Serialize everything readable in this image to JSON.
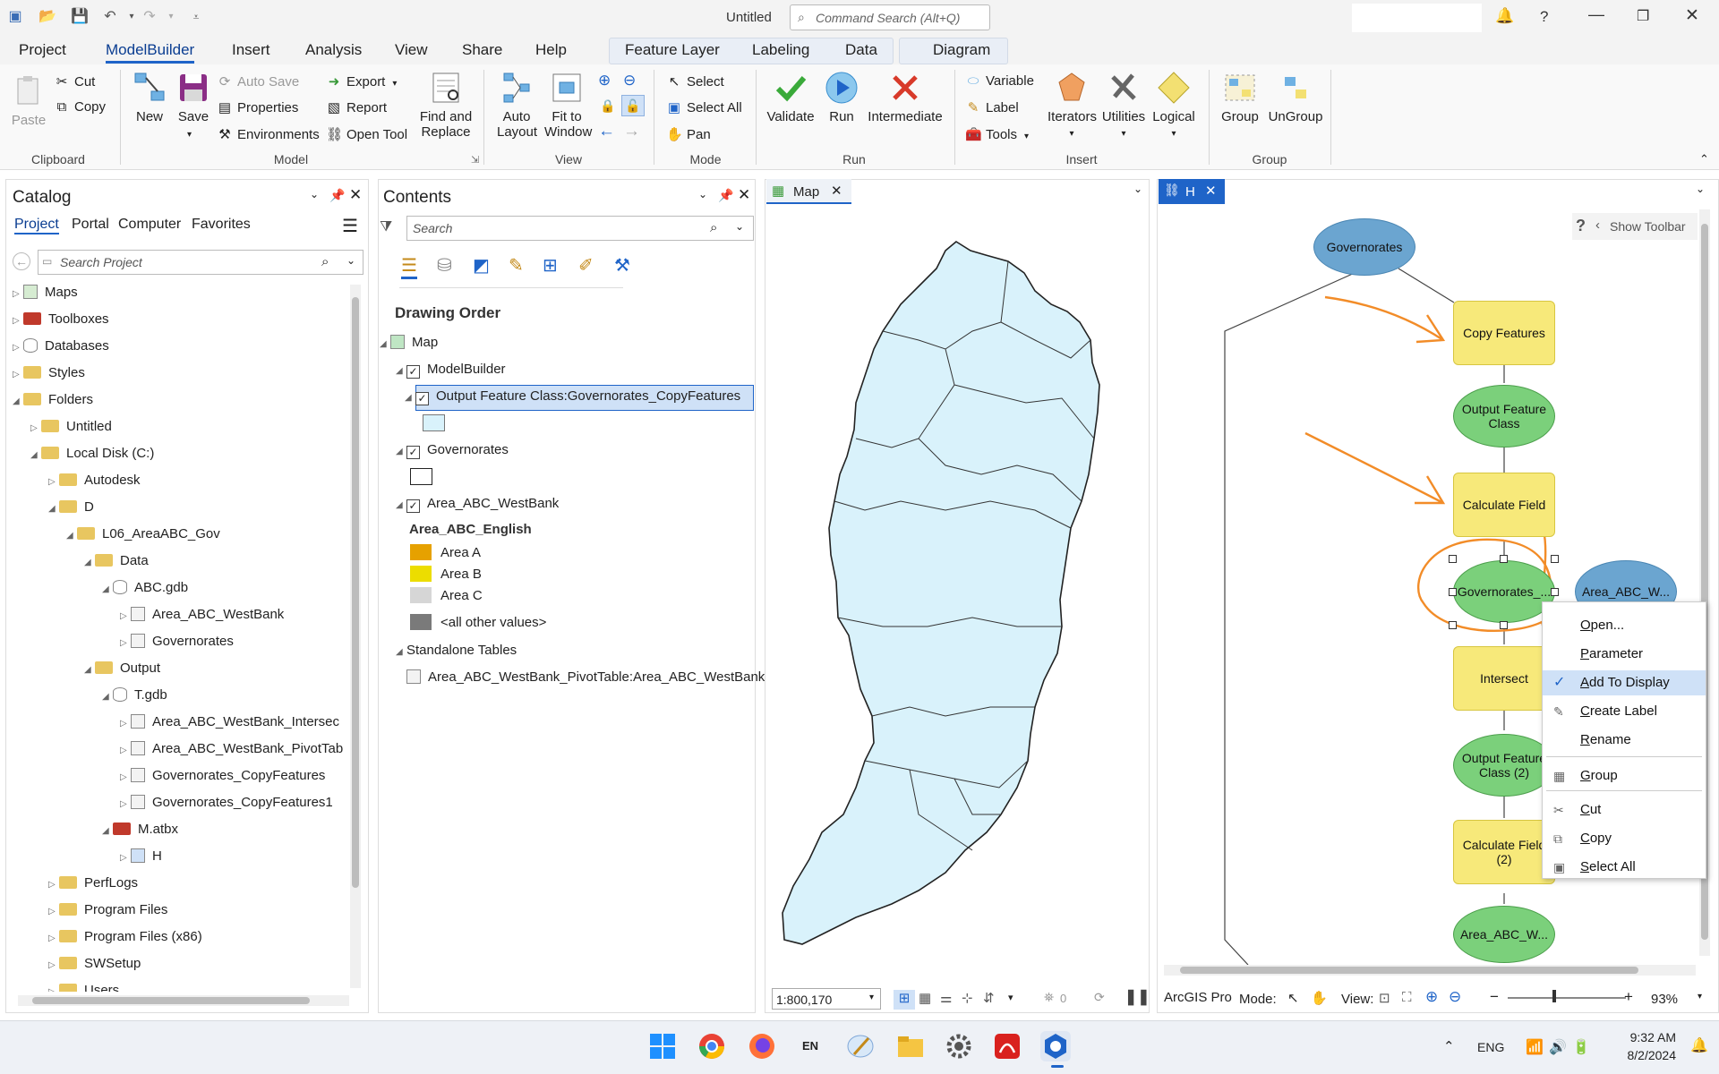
{
  "app": {
    "doc_title": "Untitled",
    "command_search_placeholder": "Command Search (Alt+Q)"
  },
  "menu_tabs": [
    "Project",
    "ModelBuilder",
    "Insert",
    "Analysis",
    "View",
    "Share",
    "Help"
  ],
  "context_tabs": [
    "Feature Layer",
    "Labeling",
    "Data"
  ],
  "diagram_tab": "Diagram",
  "ribbon": {
    "clipboard": {
      "paste": "Paste",
      "cut": "Cut",
      "copy": "Copy",
      "group": "Clipboard"
    },
    "model": {
      "new": "New",
      "save": "Save",
      "auto_save": "Auto Save",
      "properties": "Properties",
      "environments": "Environments",
      "export": "Export",
      "report": "Report",
      "open_tool": "Open Tool",
      "find_replace_1": "Find and",
      "find_replace_2": "Replace",
      "group": "Model"
    },
    "view": {
      "auto_layout_1": "Auto",
      "auto_layout_2": "Layout",
      "fit_1": "Fit to",
      "fit_2": "Window",
      "group": "View"
    },
    "mode": {
      "select": "Select",
      "select_all": "Select All",
      "pan": "Pan",
      "group": "Mode"
    },
    "run": {
      "validate": "Validate",
      "run": "Run",
      "intermediate": "Intermediate",
      "group": "Run"
    },
    "insert": {
      "variable": "Variable",
      "label": "Label",
      "tools": "Tools",
      "iterators": "Iterators",
      "utilities": "Utilities",
      "logical": "Logical",
      "group": "Insert"
    },
    "group_grp": {
      "group": "Group",
      "ungroup": "UnGroup",
      "group_label": "Group"
    }
  },
  "catalog": {
    "title": "Catalog",
    "tabs": [
      "Project",
      "Portal",
      "Computer",
      "Favorites"
    ],
    "search_placeholder": "Search Project",
    "items": [
      {
        "label": "Maps",
        "lvl": 0,
        "icon": "maps"
      },
      {
        "label": "Toolboxes",
        "lvl": 0,
        "icon": "toolbox"
      },
      {
        "label": "Databases",
        "lvl": 0,
        "icon": "db"
      },
      {
        "label": "Styles",
        "lvl": 0,
        "icon": "styles"
      },
      {
        "label": "Folders",
        "lvl": 0,
        "icon": "folder",
        "open": true
      },
      {
        "label": "Untitled",
        "lvl": 1,
        "icon": "folder"
      },
      {
        "label": "Local Disk (C:)",
        "lvl": 1,
        "icon": "folder",
        "open": true
      },
      {
        "label": "Autodesk",
        "lvl": 2,
        "icon": "folder"
      },
      {
        "label": "D",
        "lvl": 2,
        "icon": "folder",
        "open": true
      },
      {
        "label": "L06_AreaABC_Gov",
        "lvl": 3,
        "icon": "folder",
        "open": true
      },
      {
        "label": "Data",
        "lvl": 4,
        "icon": "folder",
        "open": true
      },
      {
        "label": "ABC.gdb",
        "lvl": 5,
        "icon": "gdb",
        "open": true
      },
      {
        "label": "Area_ABC_WestBank",
        "lvl": 6,
        "icon": "fc"
      },
      {
        "label": "Governorates",
        "lvl": 6,
        "icon": "fc"
      },
      {
        "label": "Output",
        "lvl": 4,
        "icon": "folder",
        "open": true
      },
      {
        "label": "T.gdb",
        "lvl": 5,
        "icon": "gdb",
        "open": true
      },
      {
        "label": "Area_ABC_WestBank_Intersec",
        "lvl": 6,
        "icon": "fc"
      },
      {
        "label": "Area_ABC_WestBank_PivotTab",
        "lvl": 6,
        "icon": "fc"
      },
      {
        "label": "Governorates_CopyFeatures",
        "lvl": 6,
        "icon": "fc"
      },
      {
        "label": "Governorates_CopyFeatures1",
        "lvl": 6,
        "icon": "fc"
      },
      {
        "label": "M.atbx",
        "lvl": 5,
        "icon": "toolbox",
        "open": true
      },
      {
        "label": "H",
        "lvl": 6,
        "icon": "model"
      },
      {
        "label": "PerfLogs",
        "lvl": 2,
        "icon": "folder"
      },
      {
        "label": "Program Files",
        "lvl": 2,
        "icon": "folder"
      },
      {
        "label": "Program Files (x86)",
        "lvl": 2,
        "icon": "folder"
      },
      {
        "label": "SWSetup",
        "lvl": 2,
        "icon": "folder"
      },
      {
        "label": "Users",
        "lvl": 2,
        "icon": "folder"
      }
    ]
  },
  "contents": {
    "title": "Contents",
    "search_placeholder": "Search",
    "drawing_order": "Drawing Order",
    "map": "Map",
    "modelbuilder": "ModelBuilder",
    "output_fc": "Output Feature Class:Governorates_CopyFeatures",
    "governorates": "Governorates",
    "area_layer": "Area_ABC_WestBank",
    "area_field": "Area_ABC_English",
    "legend": [
      {
        "label": "Area A",
        "color": "#e6a100"
      },
      {
        "label": "Area B",
        "color": "#ecdd00"
      },
      {
        "label": "Area C",
        "color": "#d6d6d6"
      },
      {
        "label": "<all other values>",
        "color": "#7a7a7a"
      }
    ],
    "standalone": "Standalone Tables",
    "pivot_table": "Area_ABC_WestBank_PivotTable:Area_ABC_WestBank..."
  },
  "map_view": {
    "tab": "Map",
    "scale": "1:800,170",
    "selected_count": "0"
  },
  "model_view": {
    "tab": "H",
    "show_toolbar": "Show Toolbar",
    "nodes": {
      "governorates": "Governorates",
      "copy_features": "Copy Features",
      "output_fc": "Output Feature Class",
      "calc_field": "Calculate Field",
      "gov_var": "Governorates_...",
      "area_var": "Area_ABC_W...",
      "intersect": "Intersect",
      "output_fc2": "Output Feature Class (2)",
      "calc_field2": "Calculate Field (2)",
      "area_out": "Area_ABC_W..."
    },
    "status": {
      "app": "ArcGIS Pro",
      "mode": "Mode:",
      "view": "View:",
      "zoom": "93%"
    }
  },
  "context_menu": [
    {
      "label": "Open...",
      "ul": "O",
      "rest": "pen..."
    },
    {
      "label": "Parameter",
      "ul": "P",
      "rest": "arameter"
    },
    {
      "label": "Add To Display",
      "ul": "A",
      "rest": "dd To Display",
      "checked": true
    },
    {
      "label": "Create Label",
      "ul": "C",
      "rest": "reate Label"
    },
    {
      "label": "Rename",
      "ul": "R",
      "rest": "ename"
    },
    {
      "label": "Group",
      "ul": "G",
      "rest": "roup"
    },
    {
      "label": "Cut",
      "ul": "C",
      "rest": "ut"
    },
    {
      "label": "Copy",
      "ul": "C",
      "rest": "opy"
    },
    {
      "label": "Select All",
      "ul": "S",
      "rest": "elect All"
    }
  ],
  "taskbar": {
    "lang": "ENG",
    "time": "9:32 AM",
    "date": "8/2/2024",
    "en_badge": "EN"
  },
  "colors": {
    "accent": "#1f64c8",
    "annotation": "#f28c28",
    "green_node": "#7bd07b",
    "yellow_node": "#f7e97a",
    "blue_node": "#6ba5d0",
    "map_fill": "#d9f2fb"
  }
}
